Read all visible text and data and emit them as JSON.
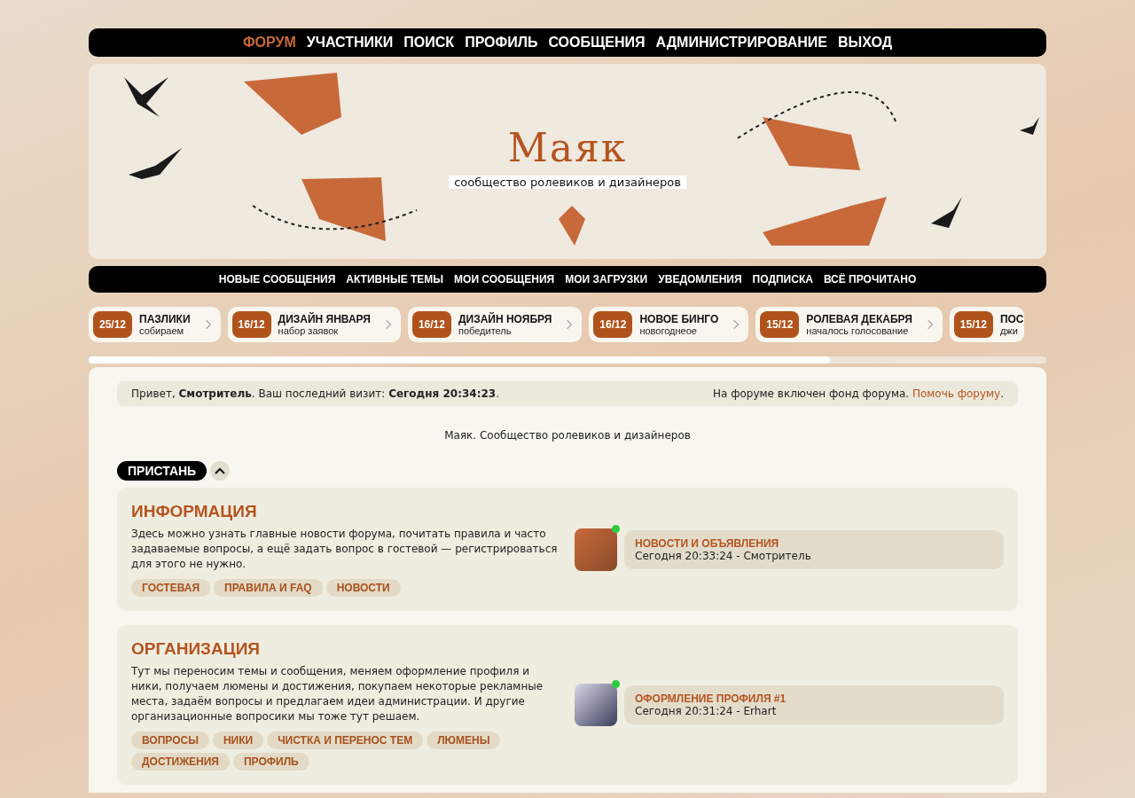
{
  "top_nav": [
    {
      "label": "ФОРУМ",
      "selected": true
    },
    {
      "label": "УЧАСТНИКИ",
      "selected": false
    },
    {
      "label": "ПОИСК",
      "selected": false
    },
    {
      "label": "ПРОФИЛЬ",
      "selected": false
    },
    {
      "label": "СООБЩЕНИЯ",
      "selected": false
    },
    {
      "label": "АДМИНИСТРИРОВАНИЕ",
      "selected": false
    },
    {
      "label": "ВЫХОД",
      "selected": false
    }
  ],
  "banner": {
    "title": "Маяк",
    "subtitle": "сообщество ролевиков и дизайнеров"
  },
  "sub_nav": [
    "НОВЫЕ СООБЩЕНИЯ",
    "АКТИВНЫЕ ТЕМЫ",
    "МОИ СООБЩЕНИЯ",
    "МОИ ЗАГРУЗКИ",
    "УВЕДОМЛЕНИЯ",
    "ПОДПИСКА",
    "ВСЁ ПРОЧИТАНО"
  ],
  "ticker": [
    {
      "date": "25/12",
      "title": "ПАЗЛИКИ",
      "subtitle": "собираем"
    },
    {
      "date": "16/12",
      "title": "ДИЗАЙН ЯНВАРЯ",
      "subtitle": "набор заявок"
    },
    {
      "date": "16/12",
      "title": "ДИЗАЙН НОЯБРЯ",
      "subtitle": "победитель"
    },
    {
      "date": "16/12",
      "title": "НОВОЕ БИНГО",
      "subtitle": "новогоднеое"
    },
    {
      "date": "15/12",
      "title": "РОЛЕВАЯ ДЕКАБРЯ",
      "subtitle": "началось голосование"
    },
    {
      "date": "15/12",
      "title": "ПОС",
      "subtitle": "джи"
    }
  ],
  "welcome": {
    "text": "Привет, **Смотритель**. Ваш последний визит: **Сегодня 20:34:23**.",
    "fund_text": "На форуме включен фонд форума.",
    "fund_link": "Помочь форуму",
    "fund_end": "."
  },
  "description": "Маяк. Сообщество ролевиков и дизайнеров",
  "category": {
    "title": "ПРИСТАНЬ",
    "expanded": true
  },
  "forums": [
    {
      "title": "ИНФОРМАЦИЯ",
      "description": "Здесь можно узнать главные новости форума, почитать правила и часто задаваемые вопросы, а ещё задать вопрос в гостевой — регистрироваться для этого не нужно.",
      "tags": [
        "ГОСТЕВАЯ",
        "ПРАВИЛА И FAQ",
        "НОВОСТИ"
      ],
      "last_topic": "НОВОСТИ И ОБЪЯВЛЕНИЯ",
      "last_post": "Сегодня 20:33:24 - Смотритель",
      "has_new": true
    },
    {
      "title": "ОРГАНИЗАЦИЯ",
      "description": "Тут мы переносим темы и сообщения, меняем оформление профиля и ники, получаем люмены и достижения, покупаем некоторые рекламные места, задаём вопросы и предлагаем идеи администрации. И другие организационные вопросики мы тоже тут решаем.",
      "tags": [
        "ВОПРОСЫ",
        "НИКИ",
        "ЧИСТКА И ПЕРЕНОС ТЕМ",
        "ЛЮМЕНЫ",
        "ДОСТИЖЕНИЯ",
        "ПРОФИЛЬ"
      ],
      "last_topic": "ОФОРМЛЕНИЕ ПРОФИЛЯ #1",
      "last_post": "Сегодня 20:31:24 - Erhart",
      "has_new": true
    }
  ]
}
